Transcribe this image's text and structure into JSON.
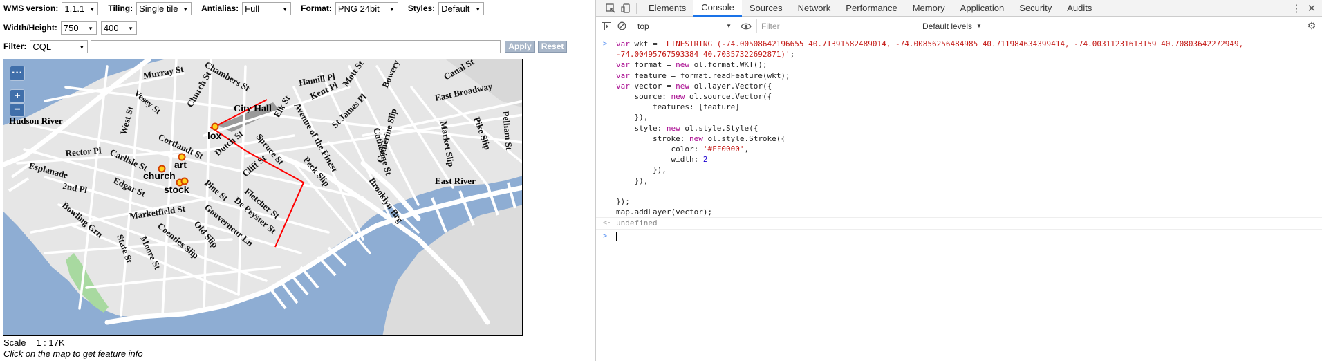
{
  "controls": {
    "wms_version": {
      "label": "WMS version:",
      "value": "1.1.1"
    },
    "tiling": {
      "label": "Tiling:",
      "value": "Single tile"
    },
    "antialias": {
      "label": "Antialias:",
      "value": "Full"
    },
    "format": {
      "label": "Format:",
      "value": "PNG 24bit"
    },
    "styles": {
      "label": "Styles:",
      "value": "Default"
    },
    "width_height": {
      "label": "Width/Height:",
      "width": "750",
      "height": "400"
    },
    "filter": {
      "label": "Filter:",
      "type": "CQL",
      "value": ""
    },
    "apply": "Apply",
    "reset": "Reset"
  },
  "map": {
    "zoom_in": "+",
    "zoom_out": "−",
    "toolbar_toggle": "···",
    "streets": [
      "Murray St",
      "Chambers St",
      "Hamill Pl",
      "Mott St",
      "Bowery",
      "Canal St",
      "Vesey St",
      "Church St",
      "Elk St",
      "Kent Pl",
      "East Broadway",
      "City Hall",
      "West St",
      "lox",
      "Spruce St",
      "Avenue of the Finest",
      "St James Pl",
      "Catherine St",
      "Market Slip",
      "Pike Slip",
      "Pelham St",
      "Cortlandt St",
      "Dutch St",
      "Catherine Slip",
      "Rector Pl",
      "Carlisle St",
      "art",
      "Esplanade",
      "church",
      "Cliff St",
      "Peck Slip",
      "Brooklyn Brg",
      "Edgar St",
      "stock",
      "Pine St",
      "Fletcher St",
      "2nd Pl",
      "De Peyster St",
      "Bowling Grn",
      "Marketfield St",
      "Gouverneur Ln",
      "State St",
      "Moore St",
      "Coenties Slip",
      "Old Slip"
    ],
    "water_labels": [
      "Hudson River",
      "East River"
    ],
    "line_color": "#FF0000"
  },
  "scale": "Scale = 1 : 17K",
  "hint": "Click on the map to get feature info",
  "devtools": {
    "tabs": [
      "Elements",
      "Console",
      "Sources",
      "Network",
      "Performance",
      "Memory",
      "Application",
      "Security",
      "Audits"
    ],
    "active_tab": "Console",
    "context": "top",
    "filter_placeholder": "Filter",
    "levels": "Default levels",
    "result": "undefined"
  }
}
